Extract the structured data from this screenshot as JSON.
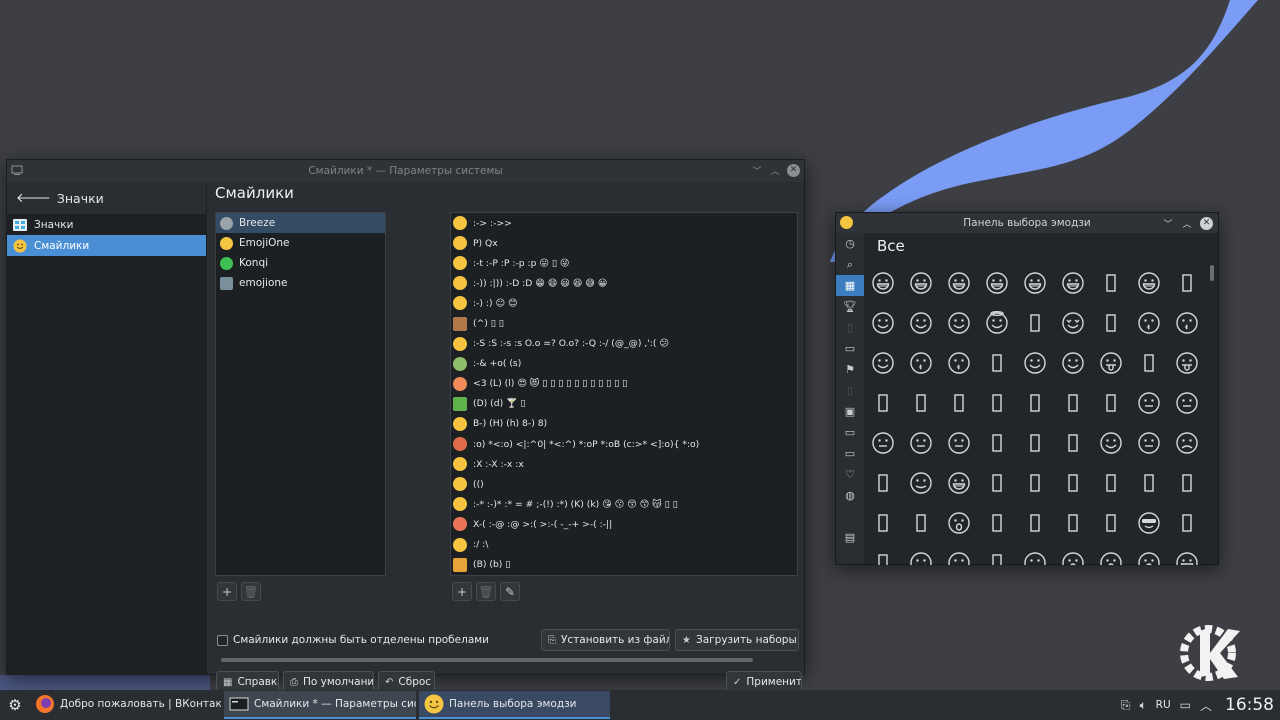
{
  "settings": {
    "title": "Смайлики * — Параметры системы",
    "back_label": "Значки",
    "sidebar_items": [
      {
        "label": "Значки",
        "icon": "icons-icon",
        "active": false
      },
      {
        "label": "Смайлики",
        "icon": "smiley-icon",
        "active": true
      }
    ],
    "page_title": "Смайлики",
    "themes": [
      {
        "label": "Breeze",
        "active": true,
        "color": "#9aa3a8"
      },
      {
        "label": "EmojiOne",
        "active": false,
        "color": "#f5c542"
      },
      {
        "label": "Konqi",
        "active": false,
        "color": "#3dbf55"
      },
      {
        "label": "emojione",
        "active": false,
        "color": "#7a8f9c"
      }
    ],
    "emoticons": [
      {
        "text": ":-> :->>",
        "color": "#f5c542"
      },
      {
        "text": "P) Qx",
        "color": "#f5c542"
      },
      {
        "text": ":-t :-P :P :-p :p 😛 ▯ 😜",
        "color": "#f5c542"
      },
      {
        "text": ":-)) :|)) :-D :D 😁 😄 😃 😆 😅 😀",
        "color": "#f5c542"
      },
      {
        "text": ":-) :) ☺ 😊",
        "color": "#f5c542"
      },
      {
        "text": "(^) ▯ ▯",
        "color": "#b07a4a"
      },
      {
        "text": ":-S :S :-s :s O.o =? O.o? :-Q :-/ (@_@) ,':( 😕",
        "color": "#f5c542"
      },
      {
        "text": ":-& +o( (s)",
        "color": "#8fbf6a"
      },
      {
        "text": "<3 (L) (l) 😍 😻 ▯ ▯ ▯ ▯ ▯ ▯ ▯ ▯ ▯ ▯ ▯",
        "color": "#f08a5d"
      },
      {
        "text": "(D) (d) 🍸 ▯",
        "color": "#5fb34a"
      },
      {
        "text": "B-) (H) (h) 8-) 8)",
        "color": "#f5c542"
      },
      {
        "text": ":o) *<:o) <|:^0| *<:^) *:oP *:oB (c:>* <]:o){ *:o)",
        "color": "#e06c4a"
      },
      {
        "text": ":X :-X :-x :x",
        "color": "#f5c542"
      },
      {
        "text": "(()",
        "color": "#f5c542"
      },
      {
        "text": ":-* :-)* :* = # ;-(!) :*) (K) (k) 😘 😗 😚 😙 😽 ▯ ▯",
        "color": "#f5c542"
      },
      {
        "text": "X-( :-@ :@ >:( >:-( -_-+ >-( :-||",
        "color": "#e8755a"
      },
      {
        "text": ":/ :\\",
        "color": "#f5c542"
      },
      {
        "text": "(B) (b) ▯",
        "color": "#e8a43a"
      }
    ],
    "checkbox_label": "Смайлики должны быть отделены пробелами",
    "install_button": "Установить из файла...",
    "download_button": "Загрузить наборы смайликов",
    "help_button": "Справка",
    "defaults_button": "По умолчанию",
    "reset_button": "Сброс",
    "apply_button": "Применить"
  },
  "emoji_picker": {
    "title": "Панель выбора эмодзи",
    "heading": "Все",
    "categories": [
      "recent-icon",
      "search-icon",
      "all-icon",
      "trophy-icon",
      "document-icon",
      "folder-icon",
      "flag-icon",
      "document-icon",
      "grid-icon",
      "folder-icon",
      "folder-icon",
      "heart-icon",
      "globe-icon",
      "table-icon"
    ],
    "active_category": 2
  },
  "taskbar": {
    "tasks": [
      {
        "label": "Добро пожаловать | ВКонтакте - ...",
        "icon": "firefox-icon"
      },
      {
        "label": "Смайлики * — Параметры системы",
        "icon": "terminal-icon"
      },
      {
        "label": "Панель выбора эмодзи",
        "icon": "emoji-icon"
      }
    ],
    "language": "RU",
    "clock": "16:58"
  }
}
